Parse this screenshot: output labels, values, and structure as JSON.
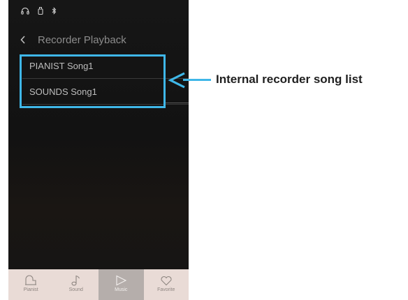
{
  "header": {
    "title": "Recorder Playback"
  },
  "songs": [
    {
      "label": "PIANIST Song1"
    },
    {
      "label": "SOUNDS Song1"
    }
  ],
  "nav": [
    {
      "label": "Pianist",
      "icon": "piano-icon"
    },
    {
      "label": "Sound",
      "icon": "music-note-icon"
    },
    {
      "label": "Music",
      "icon": "play-icon",
      "active": true
    },
    {
      "label": "Favorite",
      "icon": "heart-icon"
    }
  ],
  "status_icons": [
    "headphones-icon",
    "usb-icon",
    "bluetooth-icon"
  ],
  "annotation": {
    "text": "Internal recorder song list"
  },
  "colors": {
    "accent": "#3fb7e8",
    "background": "#141414",
    "navbar": "#e9dbd6",
    "nav_active": "#b5aeab"
  }
}
